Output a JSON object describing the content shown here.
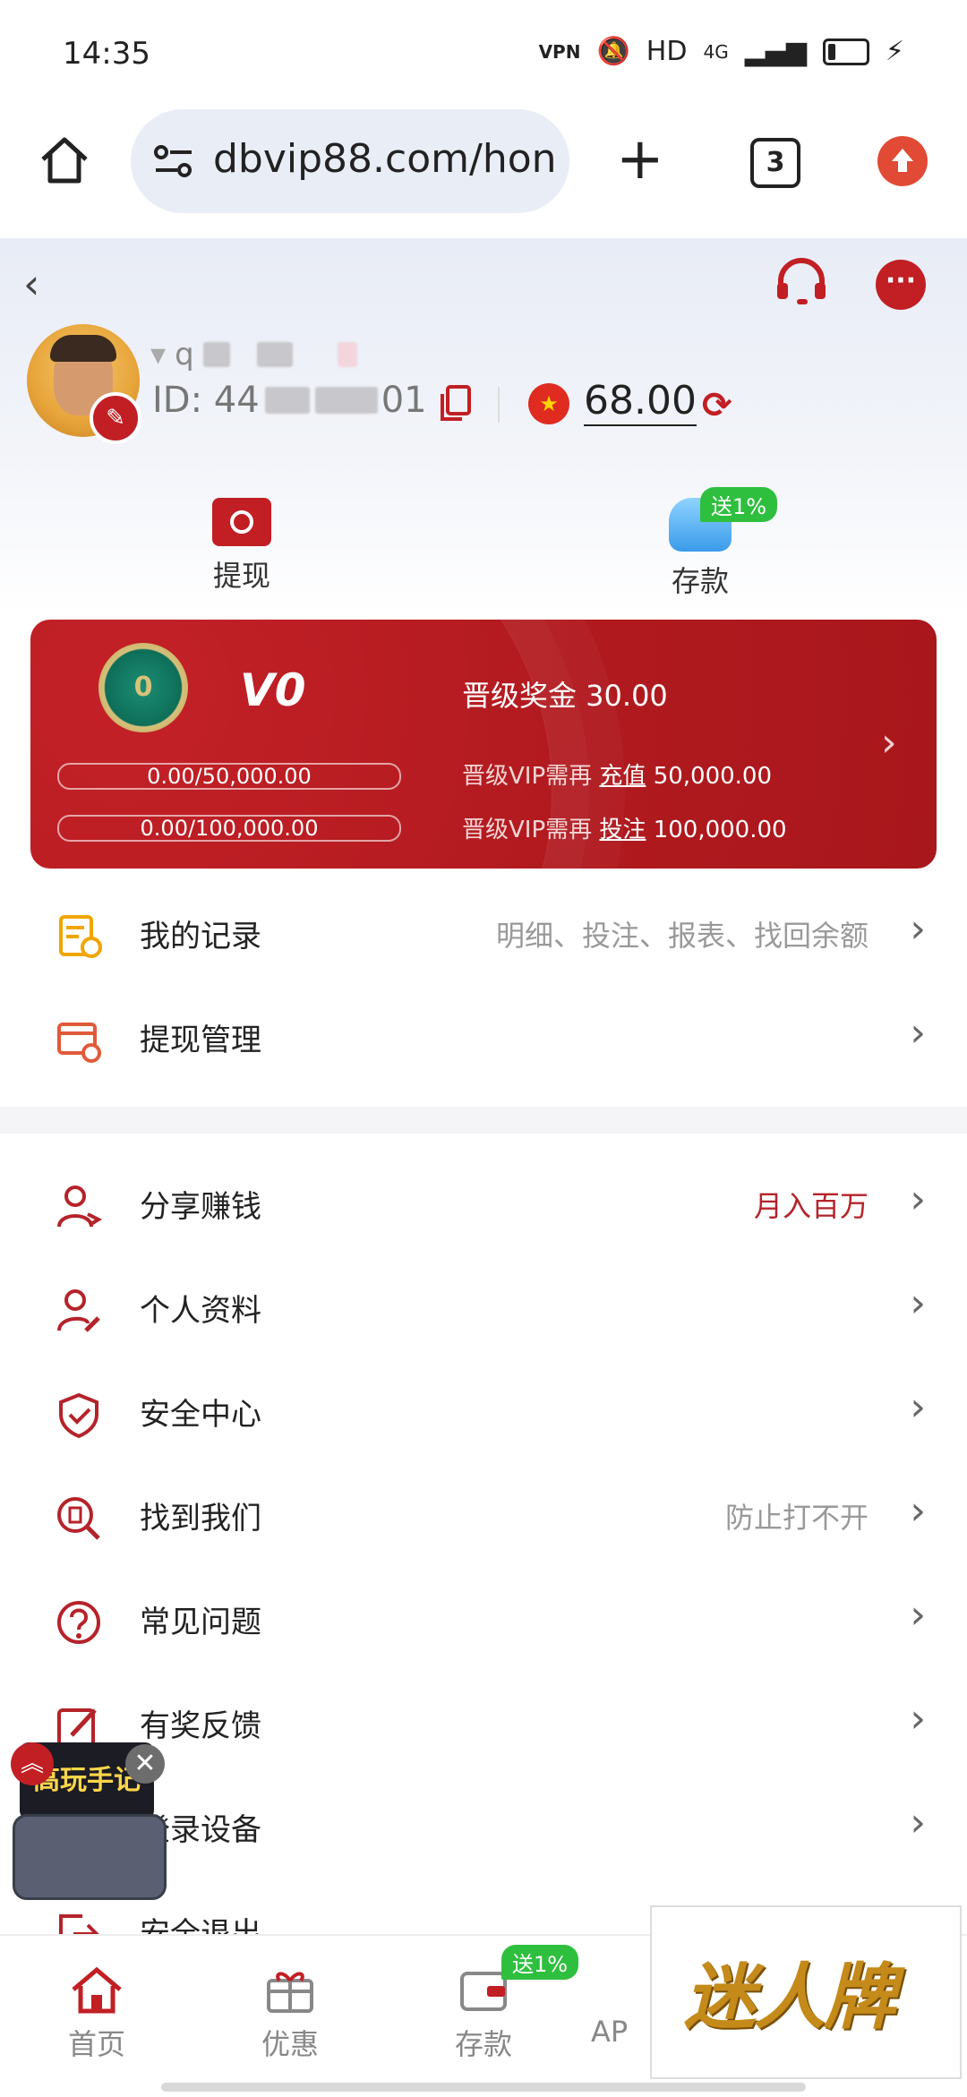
{
  "status_bar": {
    "time": "14:35",
    "indicators": [
      "VPN",
      "HD",
      "4G"
    ]
  },
  "browser": {
    "url": "dbvip88.com/hon",
    "tab_count": "3"
  },
  "header": {
    "username_visible": "q",
    "id_label": "ID: 44",
    "id_suffix": "01",
    "balance": "68.00"
  },
  "quick_actions": [
    {
      "label": "提现",
      "icon": "withdraw-icon"
    },
    {
      "label": "存款",
      "icon": "wallet-icon",
      "badge": "送1%"
    }
  ],
  "vip": {
    "level": "V0",
    "medal_text": "0",
    "progress_deposit": "0.00/50,000.00",
    "progress_bet": "0.00/100,000.00",
    "bonus_label": "晋级奖金 30.00",
    "deposit_need_prefix": "晋级VIP需再",
    "deposit_need_link": "充值",
    "deposit_need_value": "50,000.00",
    "bet_need_prefix": "晋级VIP需再",
    "bet_need_link": "投注",
    "bet_need_value": "100,000.00"
  },
  "menu_top": [
    {
      "label": "我的记录",
      "right": "明细、投注、报表、找回余额"
    },
    {
      "label": "提现管理",
      "right": ""
    }
  ],
  "menu_main": [
    {
      "label": "分享赚钱",
      "right": "月入百万"
    },
    {
      "label": "个人资料",
      "right": ""
    },
    {
      "label": "安全中心",
      "right": ""
    },
    {
      "label": "找到我们",
      "right": "防止打不开"
    },
    {
      "label": "常见问题",
      "right": ""
    },
    {
      "label": "有奖反馈",
      "right": ""
    },
    {
      "label": "登录设备",
      "right": ""
    },
    {
      "label": "安全退出",
      "right": ""
    }
  ],
  "game_widget": {
    "text": "高玩手记"
  },
  "bottom_nav": [
    {
      "label": "首页"
    },
    {
      "label": "优惠"
    },
    {
      "label": "存款",
      "badge": "送1%"
    },
    {
      "label": "AP"
    }
  ],
  "ad": {
    "text": "迷人牌"
  },
  "colors": {
    "brand_red": "#b11a1f",
    "accent_green": "#2fbf3f"
  }
}
